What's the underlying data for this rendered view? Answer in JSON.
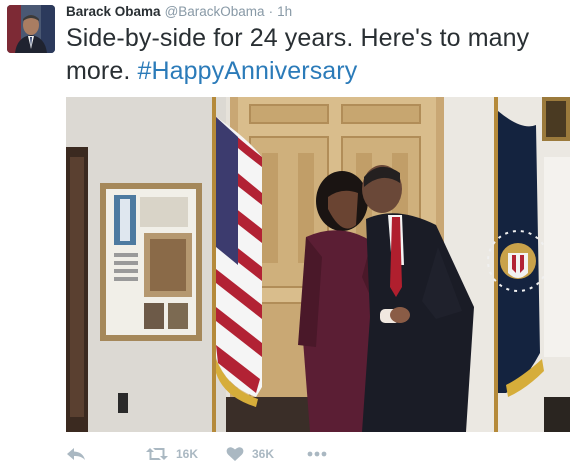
{
  "tweet": {
    "author": {
      "display_name": "Barack Obama",
      "handle": "@BarackObama",
      "separator": "·",
      "time": "1h"
    },
    "text": "Side-by-side for 24 years. Here's to many more. ",
    "hashtag": "#HappyAnniversary",
    "actions": {
      "retweet_count": "16K",
      "like_count": "36K"
    }
  },
  "colors": {
    "name": "#292f33",
    "muted": "#8899a6",
    "link": "#2b7bb9",
    "action_icons": "#aab8c2"
  },
  "icons": {
    "reply": "reply-arrow-icon",
    "retweet": "retweet-icon",
    "like": "heart-icon",
    "more": "more-dots-icon"
  }
}
